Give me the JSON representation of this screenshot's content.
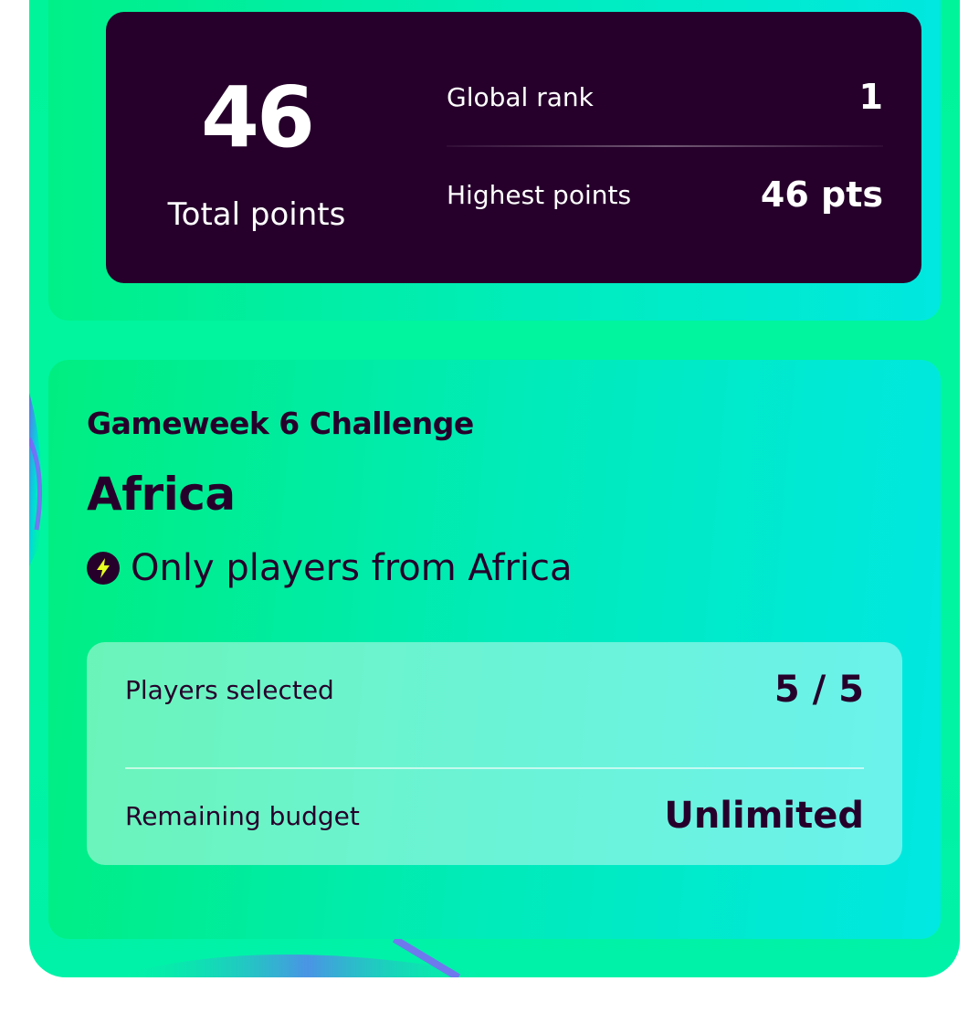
{
  "stats": {
    "total_points": "46",
    "total_label": "Total points",
    "global_rank_label": "Global rank",
    "global_rank_value": "1",
    "highest_points_label": "Highest points",
    "highest_points_value": "46 pts"
  },
  "challenge": {
    "title": "Gameweek 6 Challenge",
    "region": "Africa",
    "rule_icon": "lightning-bolt-icon",
    "rule_text": "Only players from Africa",
    "players_selected_label": "Players selected",
    "players_selected_value": "5 / 5",
    "remaining_budget_label": "Remaining budget",
    "remaining_budget_value": "Unlimited"
  },
  "colors": {
    "dark_purple": "#26002b",
    "green": "#00f59a",
    "cyan": "#00e8e2",
    "bolt_yellow": "#e6ff1f"
  }
}
